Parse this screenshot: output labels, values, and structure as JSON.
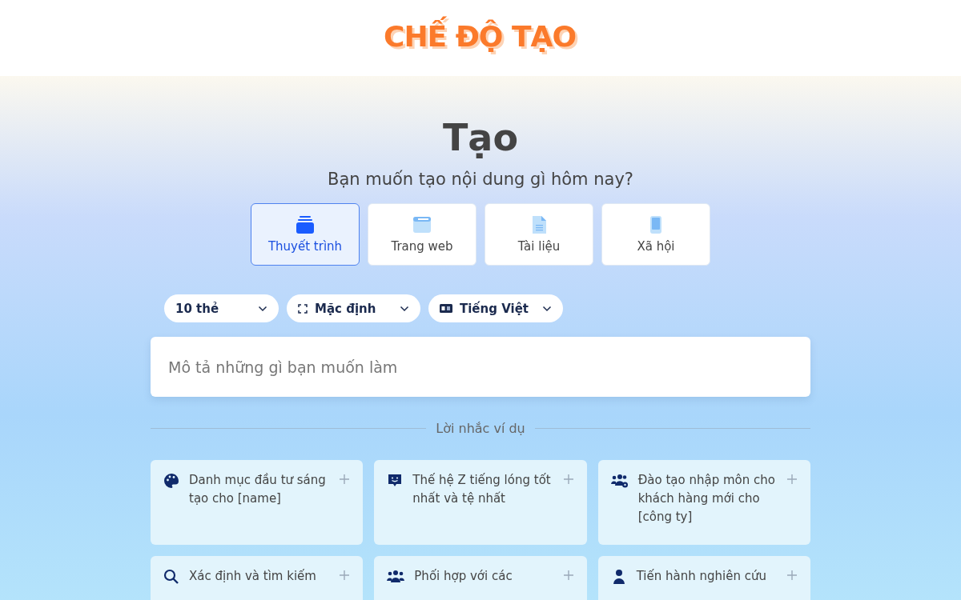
{
  "header": {
    "title": "CHẾ ĐỘ TẠO"
  },
  "heading": "Tạo",
  "subtitle": "Bạn muốn tạo nội dung gì hôm nay?",
  "tabs": [
    {
      "label": "Thuyết trình",
      "kind": "stack",
      "selected": true
    },
    {
      "label": "Trang web",
      "kind": "browser",
      "selected": false
    },
    {
      "label": "Tài liệu",
      "kind": "document",
      "selected": false
    },
    {
      "label": "Xã hội",
      "kind": "phone",
      "selected": false
    }
  ],
  "dropdowns": [
    {
      "value": "10 thẻ",
      "kind": "plain"
    },
    {
      "value": "Mặc định",
      "kind": "frame"
    },
    {
      "value": "Tiếng Việt",
      "kind": "language"
    }
  ],
  "prompt": {
    "placeholder": "Mô tả những gì bạn muốn làm"
  },
  "examples_label": "Lời nhắc ví dụ",
  "examples": [
    {
      "text": "Danh mục đầu tư sáng tạo cho [name]",
      "kind": "palette"
    },
    {
      "text": "Thế hệ Z tiếng lóng tốt nhất và tệ nhất",
      "kind": "chat"
    },
    {
      "text": "Đào tạo nhập môn cho khách hàng mới cho [công ty]",
      "kind": "team-gear"
    },
    {
      "text": "Xác định và tìm kiếm",
      "kind": "search"
    },
    {
      "text": "Phối hợp với các",
      "kind": "team"
    },
    {
      "text": "Tiến hành nghiên cứu",
      "kind": "person"
    }
  ]
}
